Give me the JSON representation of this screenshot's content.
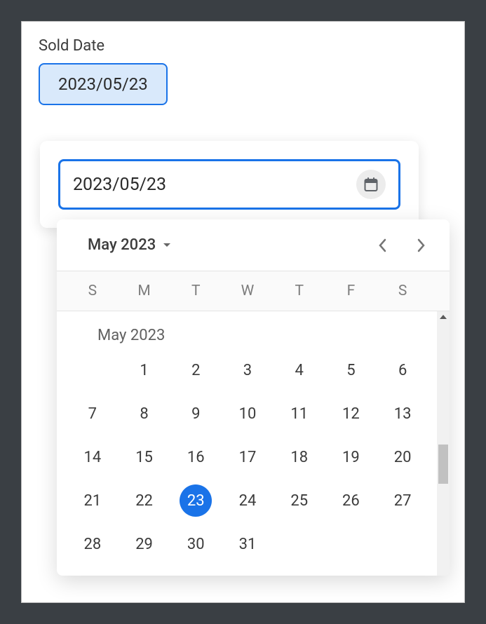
{
  "field": {
    "label": "Sold Date",
    "chip_value": "2023/05/23"
  },
  "input": {
    "value": "2023/05/23"
  },
  "calendar": {
    "header_month": "May 2023",
    "section_month": "May 2023",
    "weekdays": [
      "S",
      "M",
      "T",
      "W",
      "T",
      "F",
      "S"
    ],
    "blanks_before": 1,
    "days_in_month": 31,
    "selected_day": 23
  }
}
